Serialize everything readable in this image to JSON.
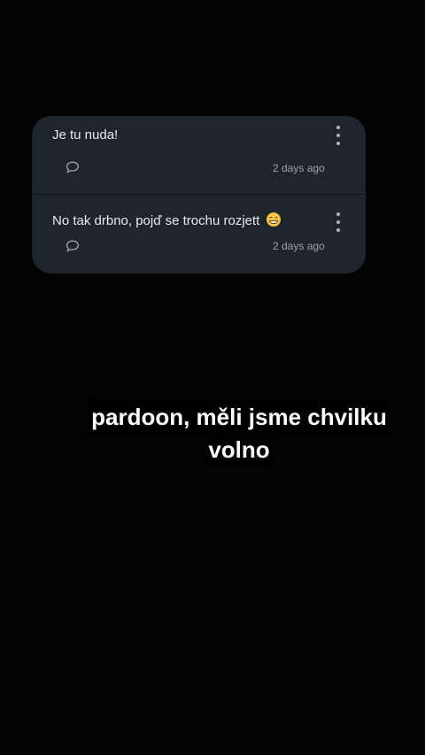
{
  "comments": [
    {
      "text": "Je tu nuda!",
      "time": "2 days ago",
      "reply_icon": "comment-bubble-icon",
      "menu_icon": "more-vertical-icon"
    },
    {
      "text": "No tak drbno, pojď se trochu rozjett",
      "emoji": "grinning-face-emoji",
      "time": "2 days ago",
      "reply_icon": "comment-bubble-icon",
      "menu_icon": "more-vertical-icon"
    }
  ],
  "caption": {
    "line1": "pardoon, měli jsme chvilku",
    "line2": "volno"
  },
  "colors": {
    "background": "#030304",
    "card": "#1f252d",
    "text": "#e7eaee",
    "muted": "#9aa1a9",
    "caption": "#ffffff"
  }
}
